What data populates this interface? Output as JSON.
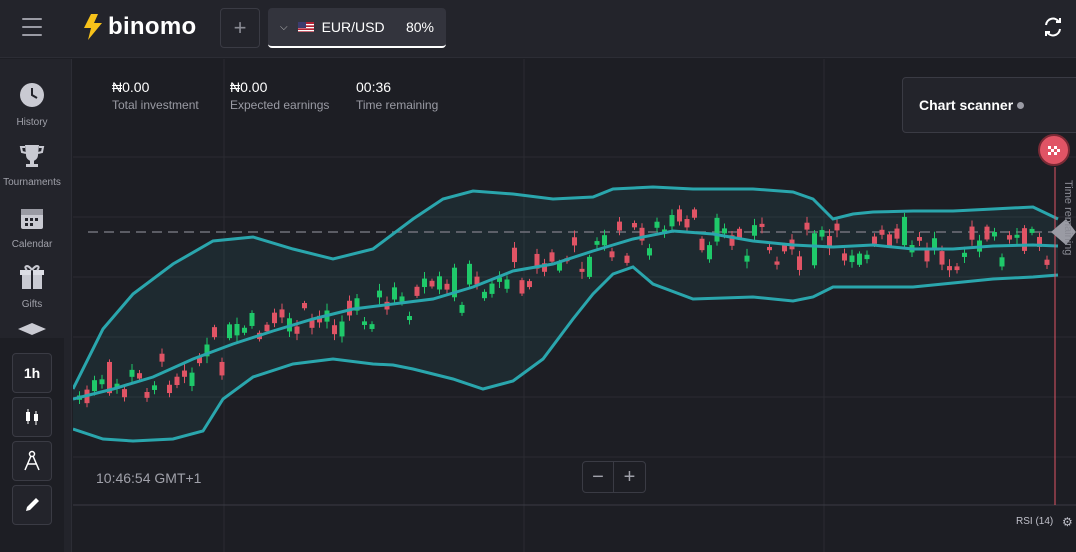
{
  "header": {
    "brand": "binomo",
    "asset_name": "EUR/USD",
    "asset_payout": "80%",
    "add_label": "+"
  },
  "sidebar": {
    "items": [
      {
        "label": "History",
        "icon": "clock-icon"
      },
      {
        "label": "Tournaments",
        "icon": "trophy-icon"
      },
      {
        "label": "Calendar",
        "icon": "calendar-icon"
      },
      {
        "label": "Gifts",
        "icon": "gift-icon"
      }
    ]
  },
  "tools": {
    "timeframe": "1h"
  },
  "stats": {
    "investment_value": "₦0.00",
    "investment_label": "Total investment",
    "earnings_value": "₦0.00",
    "earnings_label": "Expected earnings",
    "remaining_value": "00:36",
    "remaining_label": "Time remaining"
  },
  "scanner": {
    "label": "Chart scanner"
  },
  "chart": {
    "clock": "10:46:54 GMT+1",
    "indicator": "RSI (14)",
    "vertical_label": "Time remaining",
    "zoom_out": "−",
    "zoom_in": "+"
  },
  "colors": {
    "up": "#1fc96a",
    "down": "#e05465",
    "band": "#2aa6ad",
    "background": "#1d1e24"
  }
}
